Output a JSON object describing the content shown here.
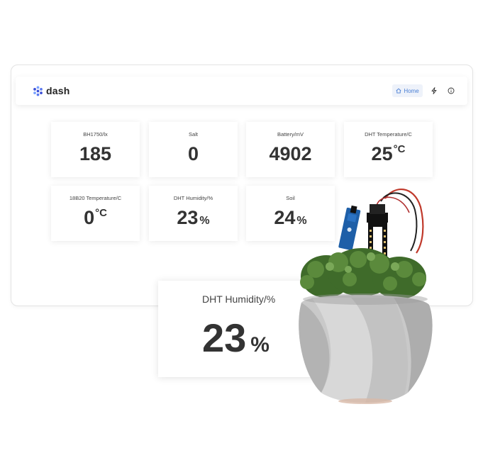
{
  "app": {
    "name": "dash"
  },
  "nav": {
    "home_label": "Home"
  },
  "icons": {
    "logo": "dots-hexagon-icon",
    "home": "home-icon",
    "bolt": "lightning-icon",
    "info": "info-circle-icon"
  },
  "colors": {
    "accent": "#4a7fd4",
    "logo_dark": "#3a4fd8",
    "logo_light": "#7aa2ff"
  },
  "cards": [
    {
      "label": "BH1750/lx",
      "value": "185",
      "unit": ""
    },
    {
      "label": "Salt",
      "value": "0",
      "unit": ""
    },
    {
      "label": "Battery/mV",
      "value": "4902",
      "unit": ""
    },
    {
      "label": "DHT Temperature/C",
      "value": "25",
      "unit": "°C"
    },
    {
      "label": "18B20 Temperature/C",
      "value": "0",
      "unit": "°C"
    },
    {
      "label": "DHT Humidity/%",
      "value": "23",
      "unit": "%"
    },
    {
      "label": "Soil",
      "value": "24",
      "unit": "%"
    }
  ],
  "featured": {
    "label": "DHT Humidity/%",
    "value": "23",
    "unit": "%"
  }
}
